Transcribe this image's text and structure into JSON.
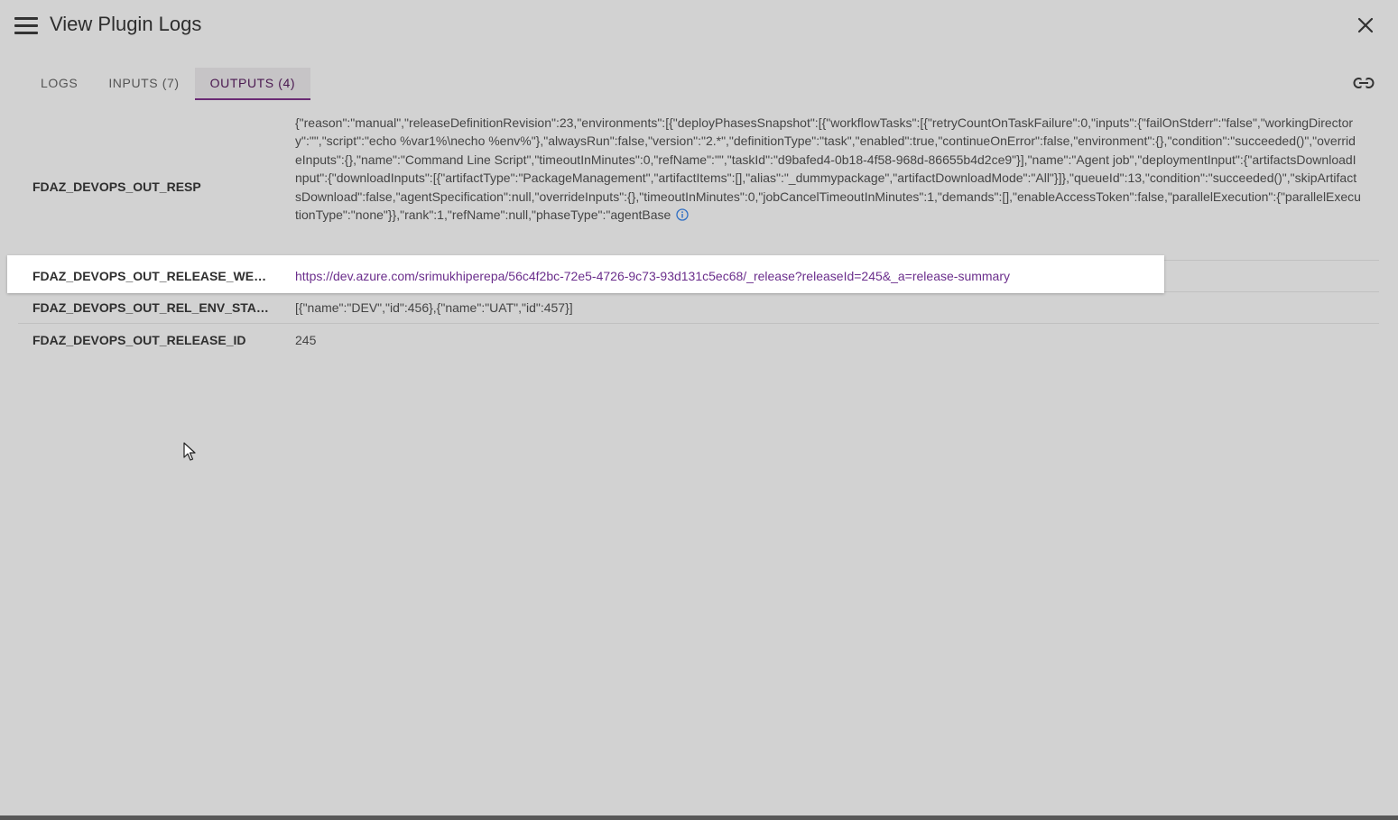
{
  "header": {
    "title": "View Plugin Logs",
    "menu_icon": "hamburger-menu-icon",
    "close_icon": "close-icon"
  },
  "tabs": [
    {
      "label": "LOGS",
      "active": false
    },
    {
      "label": "INPUTS (7)",
      "active": false
    },
    {
      "label": "OUTPUTS (4)",
      "active": true
    }
  ],
  "toolbar": {
    "link_icon": "link-icon"
  },
  "outputs": [
    {
      "name": "FDAZ_DEVOPS_OUT_RESP",
      "value": "{\"reason\":\"manual\",\"releaseDefinitionRevision\":23,\"environments\":[{\"deployPhasesSnapshot\":[{\"workflowTasks\":[{\"retryCountOnTaskFailure\":0,\"inputs\":{\"failOnStderr\":\"false\",\"workingDirectory\":\"\",\"script\":\"echo %var1%\\necho %env%\"},\"alwaysRun\":false,\"version\":\"2.*\",\"definitionType\":\"task\",\"enabled\":true,\"continueOnError\":false,\"environment\":{},\"condition\":\"succeeded()\",\"overrideInputs\":{},\"name\":\"Command Line Script\",\"timeoutInMinutes\":0,\"refName\":\"\",\"taskId\":\"d9bafed4-0b18-4f58-968d-86655b4d2ce9\"}],\"name\":\"Agent job\",\"deploymentInput\":{\"artifactsDownloadInput\":{\"downloadInputs\":[{\"artifactType\":\"PackageManagement\",\"artifactItems\":[],\"alias\":\"_dummypackage\",\"artifactDownloadMode\":\"All\"}]},\"queueId\":13,\"condition\":\"succeeded()\",\"skipArtifactsDownload\":false,\"agentSpecification\":null,\"overrideInputs\":{},\"timeoutInMinutes\":0,\"jobCancelTimeoutInMinutes\":1,\"demands\":[],\"enableAccessToken\":false,\"parallelExecution\":{\"parallelExecutionType\":\"none\"}},\"rank\":1,\"refName\":null,\"phaseType\":\"agentBase",
      "info_icon": "info-icon"
    },
    {
      "name": "FDAZ_DEVOPS_OUT_RELEASE_WEB_URL",
      "value": "https://dev.azure.com/srimukhiperepa/56c4f2bc-72e5-4726-9c73-93d131c5ec68/_release?releaseId=245&_a=release-summary"
    },
    {
      "name": "FDAZ_DEVOPS_OUT_REL_ENV_STAGES",
      "value": "[{\"name\":\"DEV\",\"id\":456},{\"name\":\"UAT\",\"id\":457}]"
    },
    {
      "name": "FDAZ_DEVOPS_OUT_RELEASE_ID",
      "value": "245"
    }
  ]
}
